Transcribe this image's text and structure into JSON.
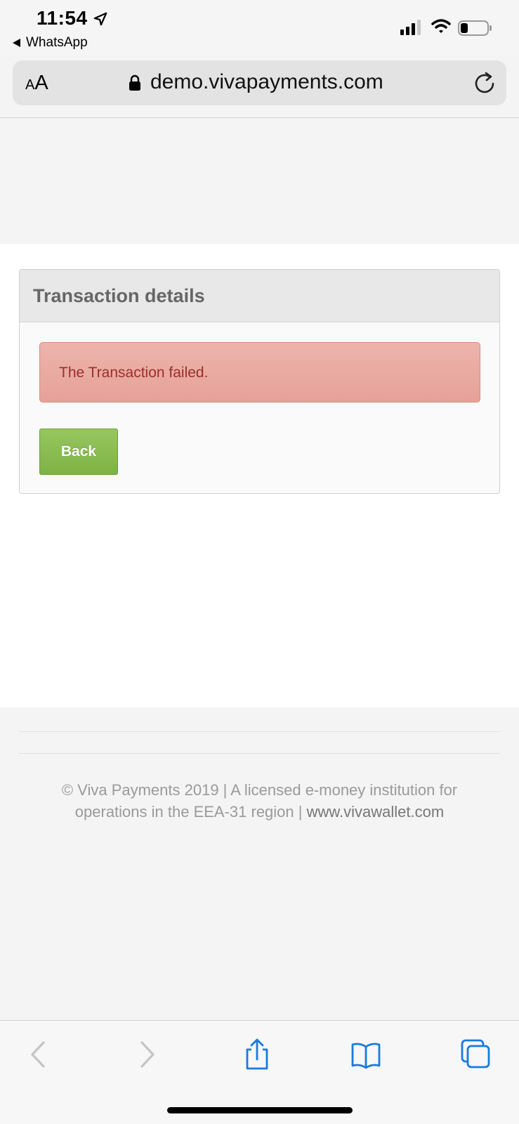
{
  "status_bar": {
    "time": "11:54",
    "back_app_label": "WhatsApp"
  },
  "browser": {
    "text_size_small": "A",
    "text_size_big": "A",
    "url": "demo.vivapayments.com"
  },
  "panel": {
    "title": "Transaction details",
    "alert_message": "The Transaction failed.",
    "back_label": "Back"
  },
  "footer": {
    "line1": "© Viva Payments 2019 | A licensed e-money institution for",
    "line2_prefix": "operations in the EEA-31 region | ",
    "link_text": "www.vivawallet.com"
  },
  "colors": {
    "alert_bg": "#e8a9a1",
    "alert_text": "#9b2e2a",
    "button_green": "#88bc51",
    "ios_blue": "#1a7ae0"
  },
  "toolbar_icons": [
    "back-arrow-icon",
    "forward-arrow-icon",
    "share-icon",
    "bookmarks-icon",
    "tabs-icon"
  ]
}
